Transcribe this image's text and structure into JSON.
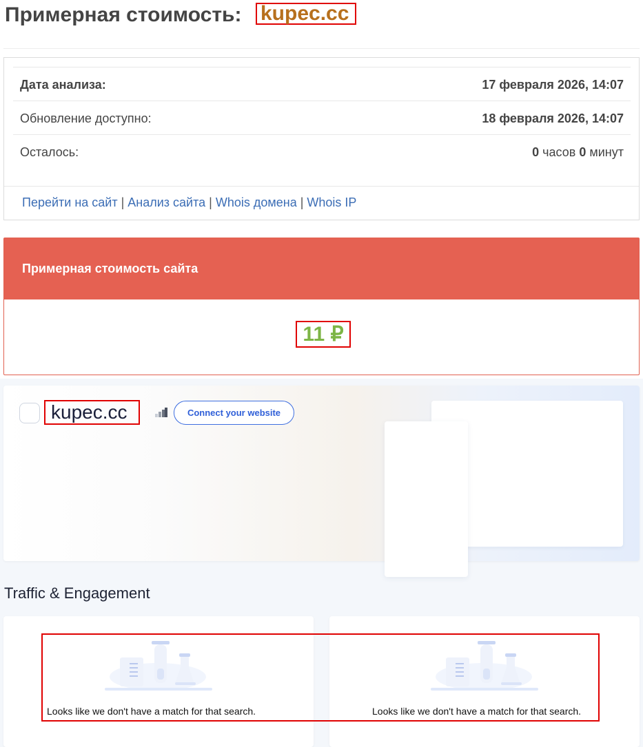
{
  "header": {
    "title_prefix": "Примерная стоимость:",
    "domain": "kupec.cc"
  },
  "info": {
    "rows": [
      {
        "label": "Дата анализа:",
        "value": "17 февраля 2026, 14:07"
      },
      {
        "label": "Обновление доступно:",
        "value": "18 февраля 2026, 14:07"
      },
      {
        "label": "Осталось:",
        "hours": "0",
        "hours_unit": "часов",
        "minutes": "0",
        "minutes_unit": "минут"
      }
    ],
    "links": [
      "Перейти на сайт",
      "Анализ сайта",
      "Whois домена",
      "Whois IP"
    ]
  },
  "cost": {
    "heading": "Примерная стоимость сайта",
    "value": "11 ₽"
  },
  "similar": {
    "site_name": "kupec.cc",
    "connect_label": "Connect your website",
    "section_title": "Traffic & Engagement",
    "empty_message_1": "Looks like we don't have a match for that search.",
    "empty_message_2": "Looks like we don't have a match for that search."
  },
  "colors": {
    "domain": "#b7701d",
    "cost_header": "#e56152",
    "cost_value": "#7db546",
    "link": "#3b6db5",
    "highlight": "#e00000",
    "connect": "#2f5fd8"
  }
}
